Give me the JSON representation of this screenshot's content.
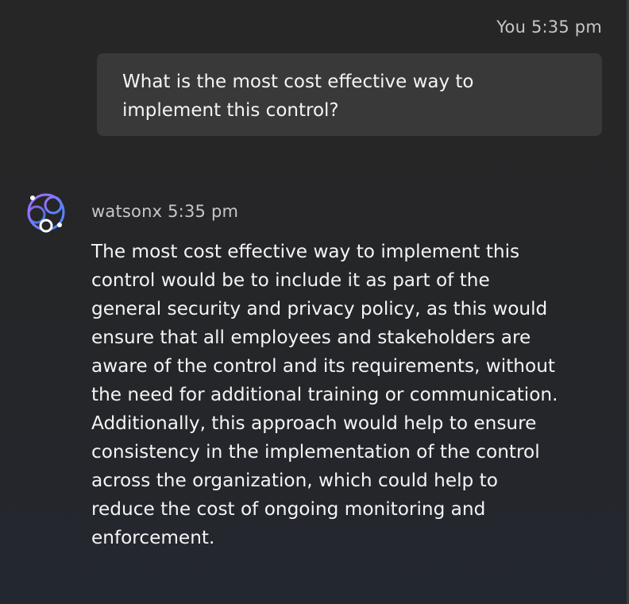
{
  "user_message": {
    "sender": "You",
    "time": "5:35 pm",
    "text": "What is the most cost effective way to implement this control?"
  },
  "bot_message": {
    "sender": "watsonx",
    "time": "5:35 pm",
    "avatar_icon": "watsonx-logo-icon",
    "lines": [
      "The most cost effective way to implement this",
      "control would be to include it as part of the",
      "general security and privacy policy, as this would",
      "ensure that all employees and stakeholders are",
      "aware of the control and its requirements, without",
      "the need for additional training or communication.",
      "Additionally, this approach would help to ensure",
      "consistency in the implementation of the control",
      "across the organization, which could help to",
      "reduce the cost of ongoing monitoring and",
      "enforcement."
    ]
  },
  "colors": {
    "background": "#262626",
    "bubble": "#393939",
    "text": "#f4f4f4",
    "meta_text": "#c6c6c6",
    "logo_purple": "#8a6ff0",
    "logo_blue": "#4589ff"
  }
}
